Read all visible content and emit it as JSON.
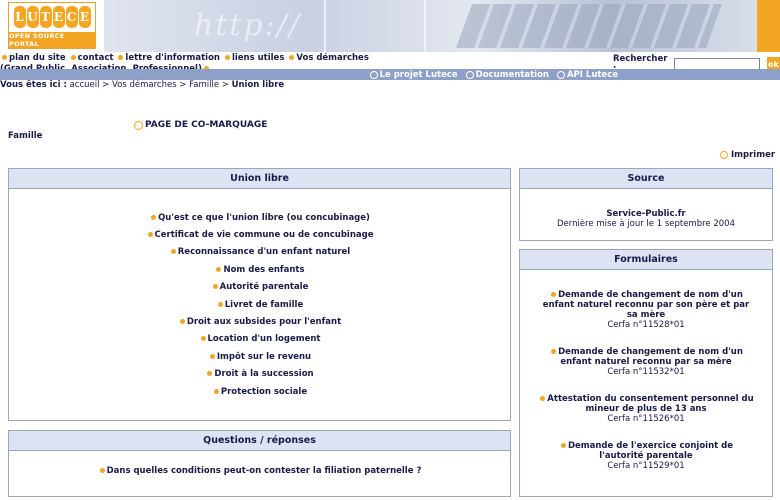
{
  "logo": {
    "word": [
      "L",
      "U",
      "T",
      "E",
      "C",
      "E"
    ],
    "subtitle": "OPEN SOURCE PORTAL"
  },
  "banner": {
    "decor_text": "http://"
  },
  "nav": {
    "items": [
      "plan du site",
      "contact",
      "lettre d'information",
      "liens utiles",
      "Vos démarches  (Grand Public, Association, Professionnel)"
    ]
  },
  "search": {
    "label": "Rechercher :",
    "value": "",
    "button": "ok"
  },
  "bluebar": {
    "links": [
      "Le projet Lutece",
      "Documentation",
      "API Lutece"
    ]
  },
  "breadcrumb": {
    "prefix": "Vous êtes ici :",
    "path": "accueil > Vos démarches > Famille >",
    "current": "Union libre"
  },
  "page": {
    "comark_title": "PAGE DE CO-MARQUAGE",
    "category": "Famille",
    "print_label": "Imprimer"
  },
  "union": {
    "title": "Union libre",
    "items": [
      "Qu'est ce que l'union libre (ou concubinage)",
      "Certificat de vie commune ou de concubinage",
      "Reconnaissance d'un enfant naturel",
      "Nom des enfants",
      "Autorité parentale",
      "Livret de famille",
      "Droit aux subsides pour l'enfant",
      "Location d'un logement",
      "Impôt sur le revenu",
      "Droit à la succession",
      "Protection sociale"
    ]
  },
  "qr": {
    "title": "Questions / réponses",
    "items": [
      "Dans quelles conditions peut-on contester la filiation paternelle ?"
    ]
  },
  "source": {
    "title": "Source",
    "name": "Service-Public.fr",
    "updated": "Dernière mise à jour le 1 septembre 2004"
  },
  "forms": {
    "title": "Formulaires",
    "items": [
      {
        "title": "Demande de changement de nom d'un enfant naturel reconnu par son père et par sa mère",
        "cerfa": "Cerfa n°11528*01"
      },
      {
        "title": "Demande de changement de nom d'un enfant naturel reconnu par sa mère",
        "cerfa": "Cerfa n°11532*01"
      },
      {
        "title": "Attestation du consentement personnel du mineur de plus de 13 ans",
        "cerfa": "Cerfa n°11526*01"
      },
      {
        "title": "Demande de l'exercice conjoint de l'autorité parentale",
        "cerfa": "Cerfa n°11529*01"
      }
    ]
  },
  "colors": {
    "accent": "#f4a623",
    "bar": "#8fa0c8",
    "box_head": "#dde3f2",
    "text": "#1a1a4a"
  }
}
